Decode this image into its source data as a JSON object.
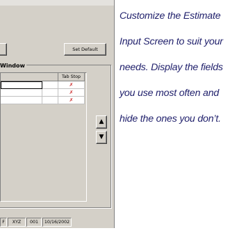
{
  "dialog": {
    "buttons": {
      "set_default": "Set Default"
    },
    "group": {
      "title": "Window"
    },
    "list": {
      "headers": [
        "Tab Stop"
      ],
      "rows": [
        {
          "tab_stop": "✗"
        },
        {
          "tab_stop": "✗"
        },
        {
          "tab_stop": "✗"
        }
      ]
    },
    "arrows": {
      "up": "▲",
      "down": "▼"
    },
    "status_bar": {
      "panes": [
        "F",
        "XYZ",
        "001",
        "10/16/2002"
      ]
    }
  },
  "caption": {
    "lines": [
      "Customize the Estimate",
      "Input Screen to suit your",
      "needs. Display the fields",
      "you use most often and",
      "hide the ones you don’t."
    ],
    "color": "#1f1f6b"
  }
}
